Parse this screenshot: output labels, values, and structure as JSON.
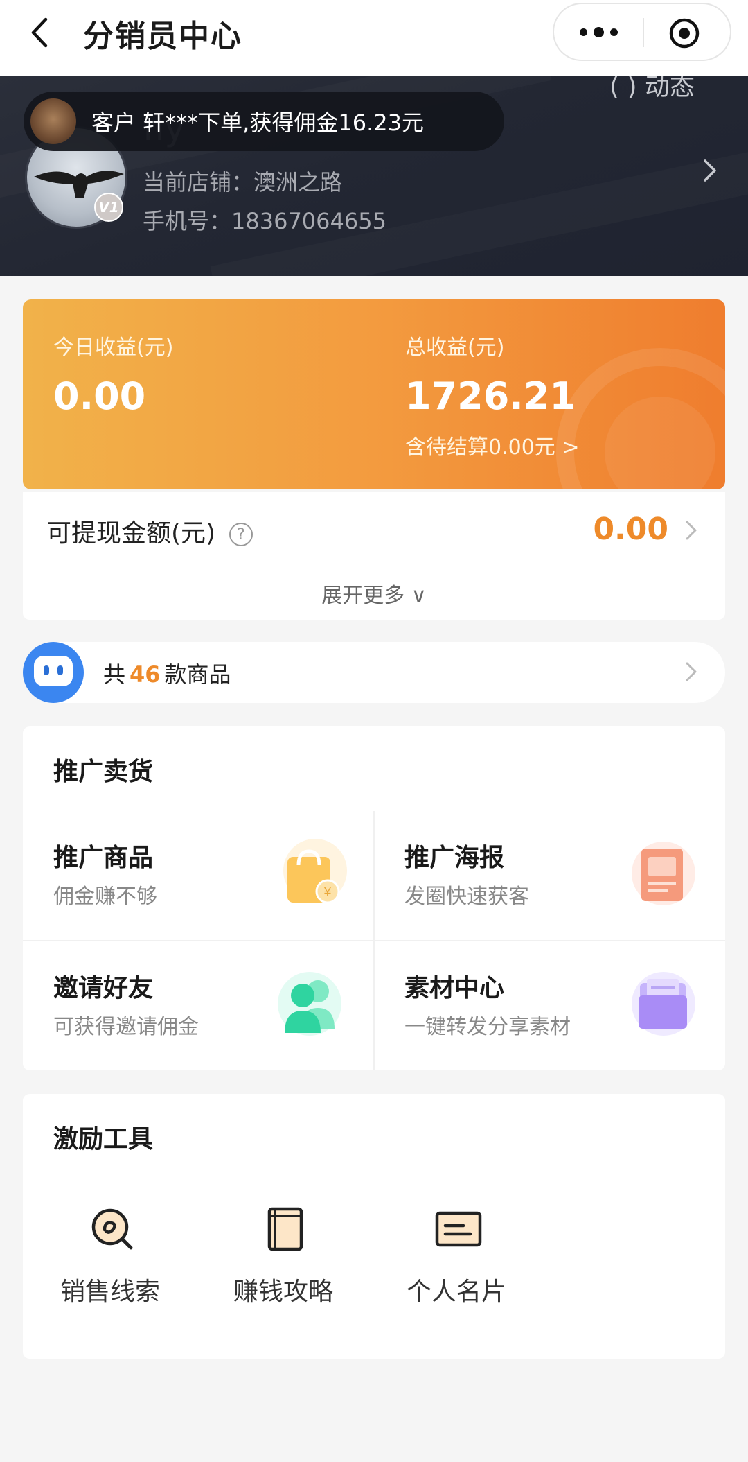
{
  "nav": {
    "title": "分销员中心",
    "more_icon": "more-dots-icon",
    "close_icon": "target-icon"
  },
  "header": {
    "top_right_text": "( ) 动态",
    "username": "fly",
    "vip_badge": "V1",
    "shop": "当前店铺：澳洲之路",
    "phone": "手机号：18367064655",
    "toast": "客户 轩***下单,获得佣金16.23元"
  },
  "earnings": {
    "today_label": "今日收益(元)",
    "today_value": "0.00",
    "total_label": "总收益(元)",
    "total_value": "1726.21",
    "pending": "含待结算0.00元 >"
  },
  "withdraw": {
    "label": "可提现金额(元)",
    "help": "?",
    "value": "0.00",
    "expand": "展开更多 ∨"
  },
  "products": {
    "prefix": "共",
    "count": "46",
    "suffix": "款商品"
  },
  "promo": {
    "title": "推广卖货",
    "cells": [
      {
        "title": "推广商品",
        "sub": "佣金赚不够",
        "icon": "shopping-bag-icon"
      },
      {
        "title": "推广海报",
        "sub": "发圈快速获客",
        "icon": "poster-icon"
      },
      {
        "title": "邀请好友",
        "sub": "可获得邀请佣金",
        "icon": "friends-icon"
      },
      {
        "title": "素材中心",
        "sub": "一键转发分享素材",
        "icon": "folder-icon"
      }
    ]
  },
  "tools": {
    "title": "激励工具",
    "items": [
      {
        "label": "销售线索",
        "icon": "sales-lead-icon"
      },
      {
        "label": "赚钱攻略",
        "icon": "guide-book-icon"
      },
      {
        "label": "个人名片",
        "icon": "business-card-icon"
      }
    ]
  },
  "colors": {
    "accent": "#ee8a2a",
    "header_bg": "#252934",
    "card_start": "#f1b24a",
    "card_end": "#ef7d2e"
  }
}
